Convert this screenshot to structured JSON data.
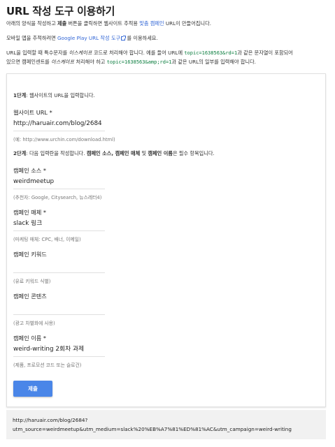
{
  "page_title": "URL 작성 도구 이용하기",
  "intro": {
    "before_submit": "아래의 양식을 작성하고 ",
    "submit_word": "제출",
    "middle": " 버튼을 클릭하면 웹사이트 추적용 ",
    "campaign_link": "맞춤 캠페인",
    "after": " URL이 만들어집니다."
  },
  "mobile": {
    "prefix": "모바일 앱을 추적하려면 ",
    "link": "Google Play URL 작성 도구",
    "suffix": " 를 이용하세요."
  },
  "escape_note": {
    "line1_a": "URL을 입력할 때 특수문자를 ",
    "line1_em": "이스케이프",
    "line1_b": " 코드로 처리해야 합니다. 예를 들어 URL에 ",
    "line1_code": "topic=1638563&rd=1",
    "line1_c": "과 같은 문자열이 포함되어",
    "line2_a": "있으면 캠페인센트를 ",
    "line2_em": "이스케이프",
    "line2_b": " 처리해야 하고 ",
    "line2_code": "topic=1638563&amp;rd=1",
    "line2_c": "과 같은 URL의 일부를 입력해야 합니다."
  },
  "step1": {
    "label": "1단계",
    "text": ": 웹사이트의 URL을 입력합니다."
  },
  "step2": {
    "label": "2단계",
    "text_a": ": 다음 입력란을 작성합니다. ",
    "bold1": "캠페인 소스, 캠페인 매체",
    "text_b": " 및 ",
    "bold2": "캠페인 이름",
    "text_c": "은 필수 항목입니다."
  },
  "fields": {
    "website_url": {
      "label": "웹사이트 URL *",
      "value": "http://haruair.com/blog/2684",
      "hint": "(예: http://www.urchin.com/download.html)"
    },
    "campaign_source": {
      "label": "캠페인 소스 *",
      "value": "weirdmeetup",
      "hint": "(추천자: Google, Citysearch, 뉴스레터4)"
    },
    "campaign_medium": {
      "label": "캠페인 매체 *",
      "value": "slack 링크",
      "hint": "(마케팅 매체: CPC, 배너, 이메일)"
    },
    "campaign_term": {
      "label": "캠페인 키워드",
      "value": "",
      "hint": "(유료 키워드 식별)"
    },
    "campaign_content": {
      "label": "캠페인 콘텐츠",
      "value": "",
      "hint": "(광고 차별화에 사용)"
    },
    "campaign_name": {
      "label": "캠페인 이름 *",
      "value": "weird-writing 2회차 과제",
      "hint": "(제품, 프로모션 코드 또는 슬로건)"
    }
  },
  "submit_label": "제출",
  "result": {
    "line1": "http://haruair.com/blog/2684?",
    "line2": "utm_source=weirdmeetup&utm_medium=slack%20%EB%A7%81%ED%81%AC&utm_campaign=weird-writing"
  },
  "colors": {
    "accent": "#4a86e8",
    "link": "#3367d6",
    "code": "#0a7d3e"
  }
}
